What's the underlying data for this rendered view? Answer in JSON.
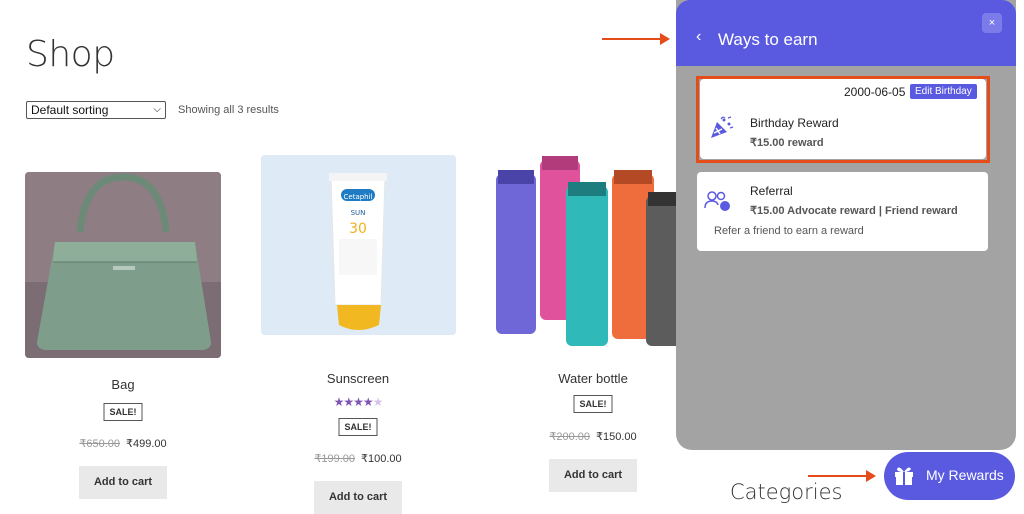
{
  "shop": {
    "title": "Shop",
    "sorting": "Default sorting",
    "result_count": "Showing all 3 results",
    "categories_heading": "Categories"
  },
  "products": [
    {
      "name": "Bag",
      "sale": "SALE!",
      "old_price": "₹650.00",
      "price": "₹499.00",
      "button": "Add to cart"
    },
    {
      "name": "Sunscreen",
      "rating": 4,
      "sale": "SALE!",
      "old_price": "₹199.00",
      "price": "₹100.00",
      "button": "Add to cart"
    },
    {
      "name": "Water bottle",
      "sale": "SALE!",
      "old_price": "₹200.00",
      "price": "₹150.00",
      "button": "Add to cart"
    }
  ],
  "panel": {
    "title": "Ways to earn",
    "close": "×",
    "back": "‹",
    "birthday": {
      "date": "2000-06-05",
      "edit_label": "Edit Birthday",
      "title": "Birthday Reward",
      "reward": "₹15.00 reward"
    },
    "referral": {
      "title": "Referral",
      "reward": "₹15.00 Advocate reward | Friend reward",
      "description": "Refer a friend to earn a reward"
    }
  },
  "launcher": {
    "label": "My Rewards"
  },
  "colors": {
    "accent": "#5a5ae0",
    "annotation": "#e44c1a",
    "panel_bg": "#a3a3a3"
  }
}
